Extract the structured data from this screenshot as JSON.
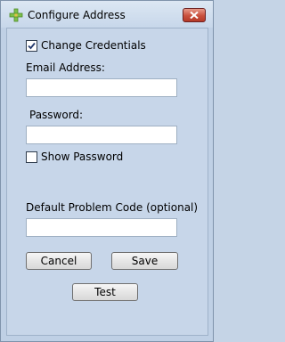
{
  "window": {
    "title": "Configure Address"
  },
  "form": {
    "change_credentials_label": "Change Credentials",
    "change_credentials_checked": true,
    "email_label": "Email Address:",
    "email_value": "",
    "password_label": "Password:",
    "password_value": "",
    "show_password_label": "Show Password",
    "show_password_checked": false,
    "problem_code_label": "Default Problem Code (optional)",
    "problem_code_value": ""
  },
  "buttons": {
    "cancel": "Cancel",
    "save": "Save",
    "test": "Test"
  },
  "icons": {
    "app": "green-plus-icon",
    "close": "close-icon",
    "check": "check-icon"
  },
  "colors": {
    "background": "#c7d6e9",
    "close_button": "#c9503d",
    "app_icon": "#6db33f"
  }
}
